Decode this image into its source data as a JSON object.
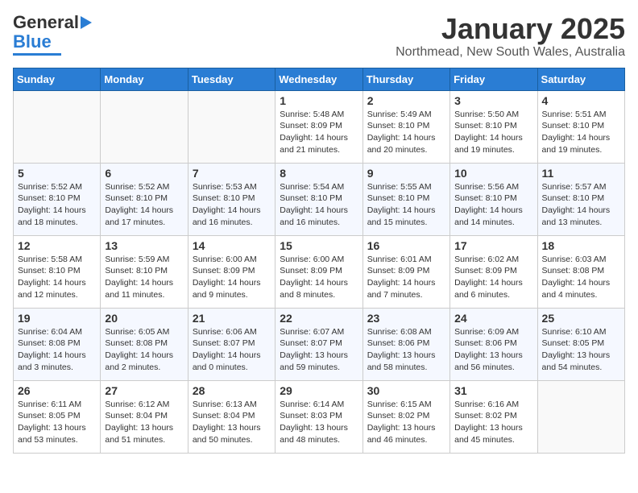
{
  "logo": {
    "line1": "General",
    "line2": "Blue"
  },
  "title": "January 2025",
  "subtitle": "Northmead, New South Wales, Australia",
  "weekdays": [
    "Sunday",
    "Monday",
    "Tuesday",
    "Wednesday",
    "Thursday",
    "Friday",
    "Saturday"
  ],
  "weeks": [
    [
      {
        "day": "",
        "info": ""
      },
      {
        "day": "",
        "info": ""
      },
      {
        "day": "",
        "info": ""
      },
      {
        "day": "1",
        "info": "Sunrise: 5:48 AM\nSunset: 8:09 PM\nDaylight: 14 hours\nand 21 minutes."
      },
      {
        "day": "2",
        "info": "Sunrise: 5:49 AM\nSunset: 8:10 PM\nDaylight: 14 hours\nand 20 minutes."
      },
      {
        "day": "3",
        "info": "Sunrise: 5:50 AM\nSunset: 8:10 PM\nDaylight: 14 hours\nand 19 minutes."
      },
      {
        "day": "4",
        "info": "Sunrise: 5:51 AM\nSunset: 8:10 PM\nDaylight: 14 hours\nand 19 minutes."
      }
    ],
    [
      {
        "day": "5",
        "info": "Sunrise: 5:52 AM\nSunset: 8:10 PM\nDaylight: 14 hours\nand 18 minutes."
      },
      {
        "day": "6",
        "info": "Sunrise: 5:52 AM\nSunset: 8:10 PM\nDaylight: 14 hours\nand 17 minutes."
      },
      {
        "day": "7",
        "info": "Sunrise: 5:53 AM\nSunset: 8:10 PM\nDaylight: 14 hours\nand 16 minutes."
      },
      {
        "day": "8",
        "info": "Sunrise: 5:54 AM\nSunset: 8:10 PM\nDaylight: 14 hours\nand 16 minutes."
      },
      {
        "day": "9",
        "info": "Sunrise: 5:55 AM\nSunset: 8:10 PM\nDaylight: 14 hours\nand 15 minutes."
      },
      {
        "day": "10",
        "info": "Sunrise: 5:56 AM\nSunset: 8:10 PM\nDaylight: 14 hours\nand 14 minutes."
      },
      {
        "day": "11",
        "info": "Sunrise: 5:57 AM\nSunset: 8:10 PM\nDaylight: 14 hours\nand 13 minutes."
      }
    ],
    [
      {
        "day": "12",
        "info": "Sunrise: 5:58 AM\nSunset: 8:10 PM\nDaylight: 14 hours\nand 12 minutes."
      },
      {
        "day": "13",
        "info": "Sunrise: 5:59 AM\nSunset: 8:10 PM\nDaylight: 14 hours\nand 11 minutes."
      },
      {
        "day": "14",
        "info": "Sunrise: 6:00 AM\nSunset: 8:09 PM\nDaylight: 14 hours\nand 9 minutes."
      },
      {
        "day": "15",
        "info": "Sunrise: 6:00 AM\nSunset: 8:09 PM\nDaylight: 14 hours\nand 8 minutes."
      },
      {
        "day": "16",
        "info": "Sunrise: 6:01 AM\nSunset: 8:09 PM\nDaylight: 14 hours\nand 7 minutes."
      },
      {
        "day": "17",
        "info": "Sunrise: 6:02 AM\nSunset: 8:09 PM\nDaylight: 14 hours\nand 6 minutes."
      },
      {
        "day": "18",
        "info": "Sunrise: 6:03 AM\nSunset: 8:08 PM\nDaylight: 14 hours\nand 4 minutes."
      }
    ],
    [
      {
        "day": "19",
        "info": "Sunrise: 6:04 AM\nSunset: 8:08 PM\nDaylight: 14 hours\nand 3 minutes."
      },
      {
        "day": "20",
        "info": "Sunrise: 6:05 AM\nSunset: 8:08 PM\nDaylight: 14 hours\nand 2 minutes."
      },
      {
        "day": "21",
        "info": "Sunrise: 6:06 AM\nSunset: 8:07 PM\nDaylight: 14 hours\nand 0 minutes."
      },
      {
        "day": "22",
        "info": "Sunrise: 6:07 AM\nSunset: 8:07 PM\nDaylight: 13 hours\nand 59 minutes."
      },
      {
        "day": "23",
        "info": "Sunrise: 6:08 AM\nSunset: 8:06 PM\nDaylight: 13 hours\nand 58 minutes."
      },
      {
        "day": "24",
        "info": "Sunrise: 6:09 AM\nSunset: 8:06 PM\nDaylight: 13 hours\nand 56 minutes."
      },
      {
        "day": "25",
        "info": "Sunrise: 6:10 AM\nSunset: 8:05 PM\nDaylight: 13 hours\nand 54 minutes."
      }
    ],
    [
      {
        "day": "26",
        "info": "Sunrise: 6:11 AM\nSunset: 8:05 PM\nDaylight: 13 hours\nand 53 minutes."
      },
      {
        "day": "27",
        "info": "Sunrise: 6:12 AM\nSunset: 8:04 PM\nDaylight: 13 hours\nand 51 minutes."
      },
      {
        "day": "28",
        "info": "Sunrise: 6:13 AM\nSunset: 8:04 PM\nDaylight: 13 hours\nand 50 minutes."
      },
      {
        "day": "29",
        "info": "Sunrise: 6:14 AM\nSunset: 8:03 PM\nDaylight: 13 hours\nand 48 minutes."
      },
      {
        "day": "30",
        "info": "Sunrise: 6:15 AM\nSunset: 8:02 PM\nDaylight: 13 hours\nand 46 minutes."
      },
      {
        "day": "31",
        "info": "Sunrise: 6:16 AM\nSunset: 8:02 PM\nDaylight: 13 hours\nand 45 minutes."
      },
      {
        "day": "",
        "info": ""
      }
    ]
  ]
}
